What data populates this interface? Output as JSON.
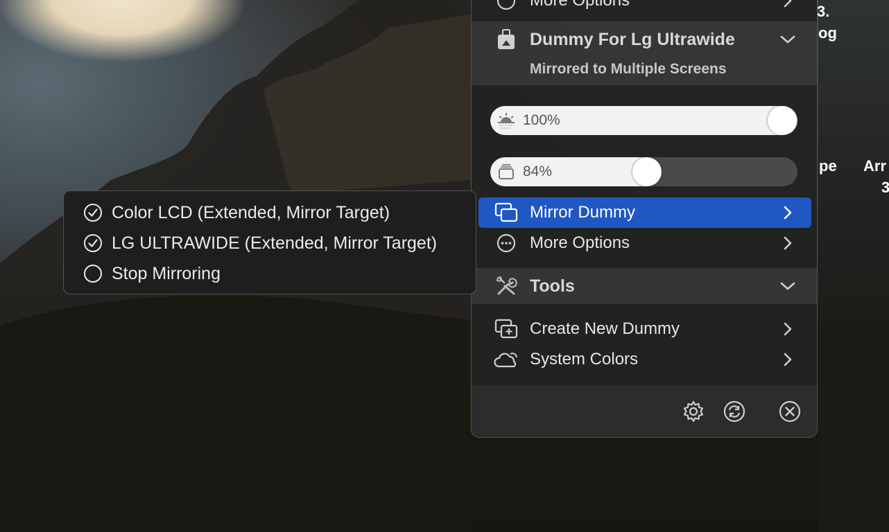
{
  "background": {
    "fragments": [
      "3.",
      "og",
      "pe",
      "Arr",
      "3"
    ]
  },
  "menu": {
    "top_item": {
      "label": "More Options",
      "icon": "ellipsis-circle-icon"
    },
    "display_section": {
      "title": "Dummy For Lg Ultrawide",
      "subtitle": "Mirrored to Multiple Screens",
      "icon": "display-dummy-icon"
    },
    "brightness": {
      "value_label": "100%",
      "level": 1.0,
      "icon": "sun-horizon-icon"
    },
    "contrast": {
      "value_label": "84%",
      "level": 0.53,
      "icon": "stack-icon"
    },
    "items": [
      {
        "label": "Mirror Dummy",
        "icon": "mirror-screens-icon",
        "highlighted": true
      },
      {
        "label": "More Options",
        "icon": "ellipsis-circle-icon",
        "highlighted": false
      }
    ],
    "tools_section": {
      "title": "Tools",
      "icon": "wrench-screwdriver-icon"
    },
    "tool_items": [
      {
        "label": "Create New Dummy",
        "icon": "add-display-icon"
      },
      {
        "label": "System Colors",
        "icon": "cloud-sun-icon"
      }
    ],
    "footer": {
      "buttons": [
        "gear-icon",
        "refresh-icon",
        "close-icon"
      ]
    }
  },
  "submenu": {
    "items": [
      {
        "label": "Color LCD (Extended, Mirror Target)",
        "checked": true
      },
      {
        "label": "LG ULTRAWIDE (Extended, Mirror Target)",
        "checked": true
      },
      {
        "label": "Stop Mirroring",
        "checked": false
      }
    ]
  },
  "colors": {
    "highlight": "#1f57c3",
    "panel_bg": "#222222",
    "text": "#e6e6e6"
  }
}
